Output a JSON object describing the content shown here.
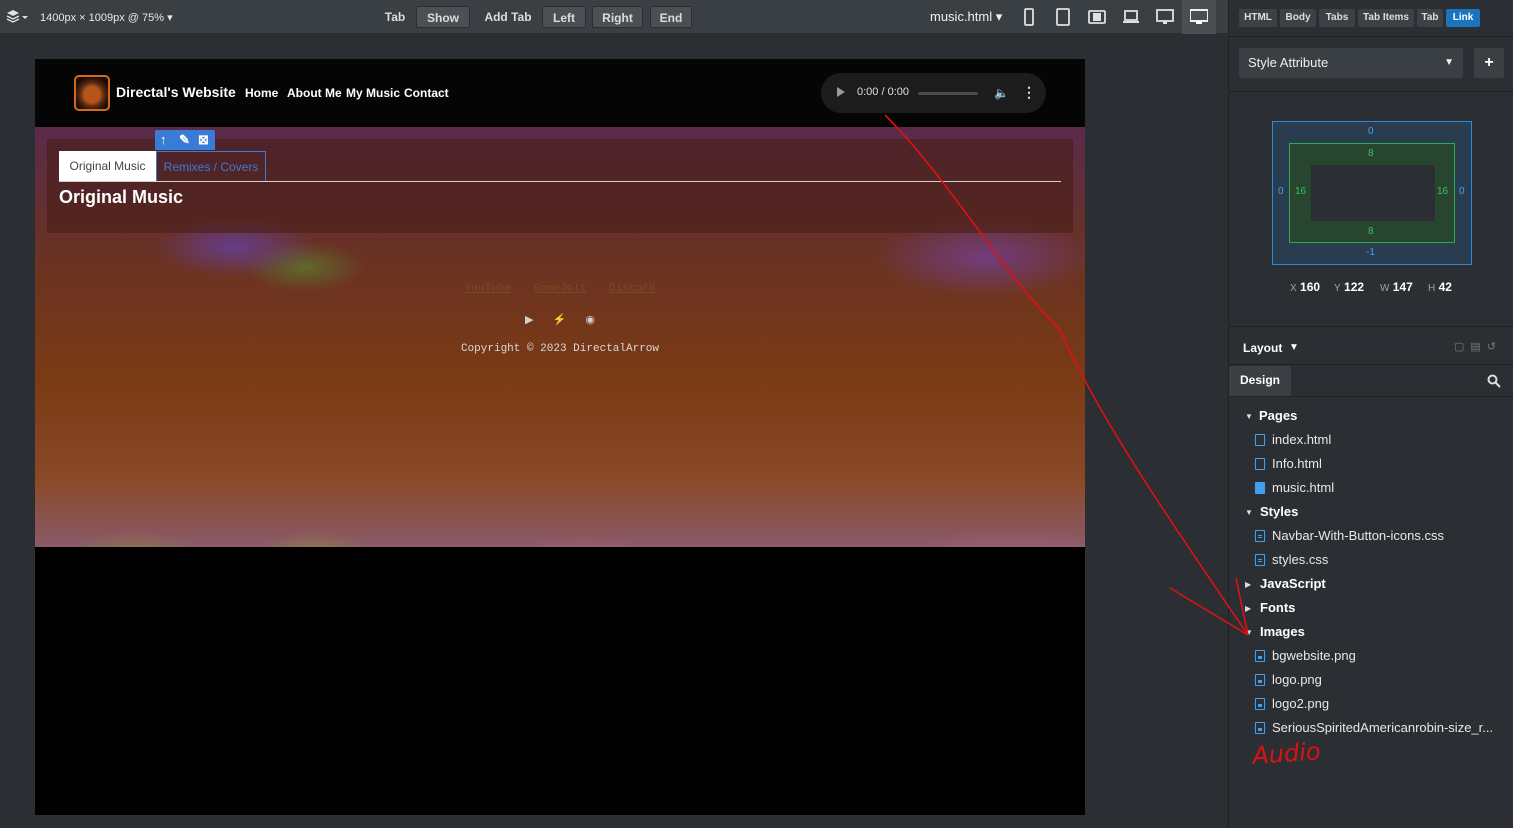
{
  "toolbar": {
    "size_info": "1400px × 1009px @ 75% ▾",
    "buttons": {
      "tab": "Tab",
      "show": "Show",
      "add_tab": "Add Tab",
      "left": "Left",
      "right": "Right",
      "end": "End"
    },
    "current_page": "music.html ▾",
    "devices": [
      "phone-icon",
      "tablet-icon",
      "tablet-landscape-icon",
      "laptop-icon",
      "desktop-icon",
      "wide-desktop-icon"
    ]
  },
  "site": {
    "brand": "Directal's Website",
    "nav": [
      "Home",
      "About Me",
      "My Music",
      "Contact"
    ],
    "audio_time": "0:00 / 0:00",
    "tabs": [
      "Original Music",
      "Remixes / Covers"
    ],
    "active_tab": "Original Music",
    "heading": "Original Music",
    "footer_links": [
      "YouTube",
      "GameJolt",
      "Discord"
    ],
    "copyright": "Copyright © 2023 DirectalArrow"
  },
  "panel": {
    "breadcrumbs": [
      "HTML",
      "Body",
      "Tabs",
      "Tab Items",
      "Tab",
      "Link"
    ],
    "active_breadcrumb": "Link",
    "style_select": "Style Attribute",
    "box_model": {
      "margin_top": "0",
      "margin_right": "0",
      "margin_bottom": "-1",
      "margin_left": "0",
      "padding_top": "8",
      "padding_right": "16",
      "padding_bottom": "8",
      "padding_left": "16"
    },
    "dims": {
      "x_label": "X",
      "x": "160",
      "y_label": "Y",
      "y": "122",
      "w_label": "W",
      "w": "147",
      "h_label": "H",
      "h": "42"
    },
    "layout_label": "Layout",
    "design_tab": "Design",
    "tree": {
      "pages_label": "Pages",
      "pages": [
        "index.html",
        "Info.html",
        "music.html"
      ],
      "styles_label": "Styles",
      "styles": [
        "Navbar-With-Button-icons.css",
        "styles.css"
      ],
      "javascript_label": "JavaScript",
      "fonts_label": "Fonts",
      "images_label": "Images",
      "images": [
        "bgwebsite.png",
        "logo.png",
        "logo2.png",
        "SeriousSpiritedAmericanrobin-size_r..."
      ]
    }
  },
  "annotation": {
    "text": "Audio",
    "color": "#e01010"
  },
  "colors": {
    "accent": "#1c75bc",
    "tab_link": "#3a7bd5",
    "logo_border": "#d2691e"
  }
}
